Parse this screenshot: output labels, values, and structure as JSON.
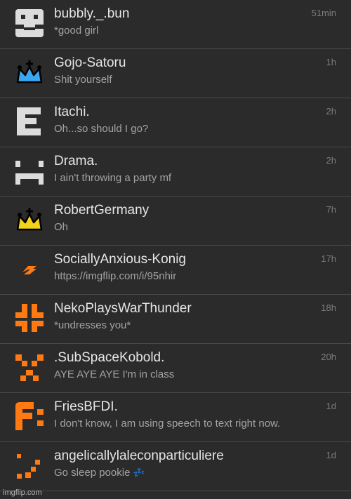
{
  "chats": [
    {
      "name": "bubbly._.bun",
      "message": "*good girl",
      "time": "51min",
      "avatar": "white-pixel-face-icon"
    },
    {
      "name": "Gojo-Satoru",
      "message": "Shit yourself",
      "time": "1h",
      "avatar": "blue-crown-icon"
    },
    {
      "name": "Itachi.",
      "message": "Oh...so should I go?",
      "time": "2h",
      "avatar": "white-e-icon"
    },
    {
      "name": "Drama.",
      "message": "I ain't throwing a party mf",
      "time": "2h",
      "avatar": "white-pixel-face-icon"
    },
    {
      "name": "RobertGermany",
      "message": "Oh",
      "time": "7h",
      "avatar": "yellow-crown-icon"
    },
    {
      "name": "SociallyAnxious-Konig",
      "message": "https://imgflip.com/i/95nhir",
      "time": "17h",
      "avatar": "orange-bolt-icon"
    },
    {
      "name": "NekoPlaysWarThunder",
      "message": "*undresses you*",
      "time": "18h",
      "avatar": "orange-pixel-icon"
    },
    {
      "name": ".SubSpaceKobold.",
      "message": "AYE AYE AYE I'm in class",
      "time": "20h",
      "avatar": "orange-pixel-face-icon"
    },
    {
      "name": "FriesBFDI.",
      "message": "I don't know, I am using speech to text right now.",
      "time": "1d",
      "avatar": "orange-f-icon"
    },
    {
      "name": "angelicallylaleconparticuliere",
      "message": "Go sleep pookie",
      "emoji": "💤",
      "time": "1d",
      "avatar": "orange-pixel-smile-icon"
    }
  ],
  "watermark": "imgflip.com",
  "colors": {
    "background": "#2b2b2b",
    "white": "#dcdcdc",
    "orange": "#ff7a12",
    "blue": "#3aa7f2",
    "yellow": "#f3d21b"
  }
}
